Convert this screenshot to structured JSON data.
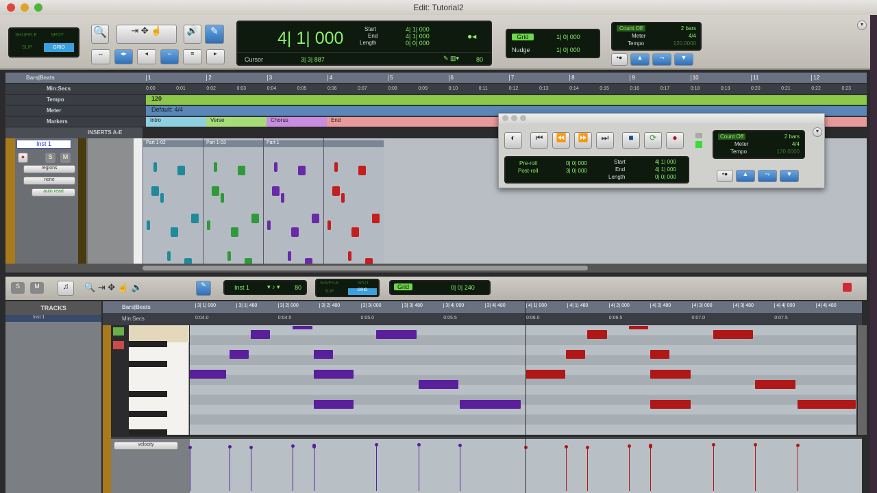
{
  "window": {
    "title": "Edit: Tutorial2"
  },
  "edit_modes": {
    "shuffle": "SHUFFLE",
    "spot": "SPOT",
    "slip": "SLIP",
    "grid": "GRID"
  },
  "counter": {
    "main": "4| 1| 000",
    "start_label": "Start",
    "end_label": "End",
    "length_label": "Length",
    "start": "4| 1| 000",
    "end": "4| 1| 000",
    "length": "0| 0| 000",
    "cursor_label": "Cursor",
    "cursor": "3| 3| 887",
    "nudge_value": "80"
  },
  "grid": {
    "grid_label": "Grid",
    "grid_value": "1| 0| 000",
    "nudge_label": "Nudge",
    "nudge_value": "1| 0| 000"
  },
  "mini_transport": {
    "count_off": "Count Off",
    "bars": "2 bars",
    "meter_label": "Meter",
    "meter": "4/4",
    "tempo_label": "Tempo",
    "tempo": "120.0000"
  },
  "rulers": {
    "bars_label": "Bars|Beats",
    "min_label": "Min:Secs",
    "tempo_label": "Tempo",
    "meter_label": "Meter",
    "markers_label": "Markers",
    "bars": [
      "1",
      "2",
      "3",
      "4",
      "5",
      "6",
      "7",
      "8",
      "9",
      "10",
      "11",
      "12"
    ],
    "secs": [
      "0:00",
      "0:01",
      "0:02",
      "0:03",
      "0:04",
      "0:05",
      "0:06",
      "0:07",
      "0:08",
      "0:09",
      "0:10",
      "0:11",
      "0:12",
      "0:13",
      "0:14",
      "0:15",
      "0:16",
      "0:17",
      "0:18",
      "0:19",
      "0:20",
      "0:21",
      "0:22",
      "0:23"
    ],
    "tempo": "120",
    "meter": "Default: 4/4",
    "markers": [
      {
        "name": "Intro",
        "color": "#8fd0e0"
      },
      {
        "name": "Verse",
        "color": "#a6dc78"
      },
      {
        "name": "Chorus",
        "color": "#c98ce0"
      },
      {
        "name": "End",
        "color": "#e89a9a"
      }
    ]
  },
  "track": {
    "inserts_label": "INSERTS A-E",
    "name": "Inst 1",
    "solo": "S",
    "mute": "M",
    "playlist": "regions",
    "group": "none",
    "automation": "auto read"
  },
  "clips": [
    {
      "name": "Part 1-02",
      "color": "#1f8a9a"
    },
    {
      "name": "Part 1-03",
      "color": "#2e9a3a"
    },
    {
      "name": "Part 1",
      "color": "#6a2aa8"
    },
    {
      "name": "",
      "color": "#c41e1e"
    }
  ],
  "transport": {
    "preroll_label": "Pre-roll",
    "postroll_label": "Post-roll",
    "preroll": "0| 0| 000",
    "postroll": "3| 0| 000",
    "start_label": "Start",
    "end_label": "End",
    "length_label": "Length",
    "start": "4| 1| 000",
    "end": "4| 1| 000",
    "length": "0| 0| 000",
    "count_off": "Count Off",
    "bars": "2 bars",
    "meter_label": "Meter",
    "meter": "4/4",
    "tempo_label": "Tempo",
    "tempo": "120.0000"
  },
  "midi_editor": {
    "solo": "S",
    "mute": "M",
    "track_sel": "Inst 1",
    "nudge": "80",
    "grid_label": "Grid",
    "grid_value": "0| 0| 240",
    "tracks_header": "TRACKS",
    "track_item": "Inst 1",
    "bars_label": "Bars|Beats",
    "min_label": "Min:Secs",
    "velocity_label": "velocity",
    "bar_ticks": [
      "3| 1| 000",
      "3| 1| 480",
      "3| 2| 000",
      "3| 2| 480",
      "3| 3| 000",
      "3| 3| 480",
      "3| 4| 000",
      "3| 4| 480",
      "4| 1| 000",
      "4| 1| 480",
      "4| 2| 000",
      "4| 2| 480",
      "4| 3| 000",
      "4| 3| 480",
      "4| 4| 000",
      "4| 4| 480"
    ],
    "sec_ticks": [
      "0:04.0",
      "0:04.5",
      "0:05.0",
      "0:05.5",
      "0:06.0",
      "0:06.5",
      "0:07.0",
      "0:07.5"
    ],
    "purple": "#5a1f9a",
    "red": "#b01818",
    "notes": [
      {
        "beat": 0.67,
        "len": 0.25,
        "row": 0,
        "c": "purple"
      },
      {
        "beat": 1.18,
        "len": 0.25,
        "row": -1,
        "c": "purple"
      },
      {
        "beat": 2.19,
        "len": 0.5,
        "row": 0,
        "c": "purple"
      },
      {
        "beat": 0.41,
        "len": 0.25,
        "row": 2,
        "c": "purple"
      },
      {
        "beat": 1.43,
        "len": 0.25,
        "row": 2,
        "c": "purple"
      },
      {
        "beat": -0.07,
        "len": 0.46,
        "row": 4,
        "c": "purple"
      },
      {
        "beat": 1.43,
        "len": 0.5,
        "row": 4,
        "c": "purple"
      },
      {
        "beat": 2.7,
        "len": 0.5,
        "row": 5,
        "c": "purple"
      },
      {
        "beat": 1.43,
        "len": 0.5,
        "row": 7,
        "c": "purple"
      },
      {
        "beat": 3.2,
        "len": 0.75,
        "row": 7,
        "c": "purple"
      },
      {
        "beat": 4.74,
        "len": 0.25,
        "row": 0,
        "c": "red"
      },
      {
        "beat": 5.24,
        "len": 0.25,
        "row": -1,
        "c": "red"
      },
      {
        "beat": 6.26,
        "len": 0.5,
        "row": 0,
        "c": "red"
      },
      {
        "beat": 4.48,
        "len": 0.25,
        "row": 2,
        "c": "red"
      },
      {
        "beat": 5.5,
        "len": 0.25,
        "row": 2,
        "c": "red"
      },
      {
        "beat": 3.99,
        "len": 0.5,
        "row": 4,
        "c": "red"
      },
      {
        "beat": 5.5,
        "len": 0.5,
        "row": 4,
        "c": "red"
      },
      {
        "beat": 6.77,
        "len": 0.5,
        "row": 5,
        "c": "red"
      },
      {
        "beat": 5.5,
        "len": 0.5,
        "row": 7,
        "c": "red"
      },
      {
        "beat": 7.28,
        "len": 0.72,
        "row": 7,
        "c": "red"
      }
    ]
  }
}
